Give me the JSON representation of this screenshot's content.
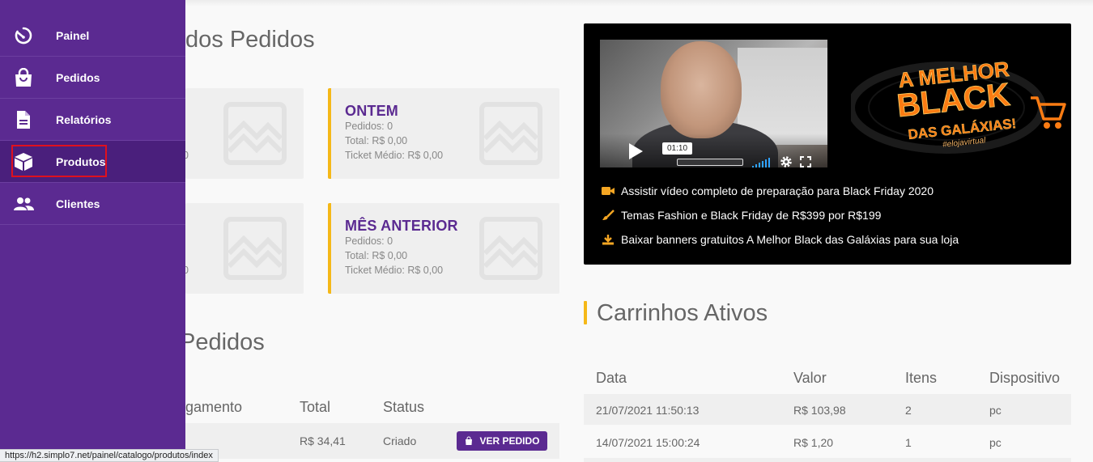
{
  "sidebar": {
    "items": [
      {
        "label": "Painel",
        "icon": "timer-icon"
      },
      {
        "label": "Pedidos",
        "icon": "shopping-bag-icon"
      },
      {
        "label": "Relatórios",
        "icon": "document-icon"
      },
      {
        "label": "Produtos",
        "icon": "box-icon"
      },
      {
        "label": "Clientes",
        "icon": "people-icon"
      }
    ],
    "active": "Produtos"
  },
  "summary": {
    "title": "dos Pedidos",
    "cards": [
      {
        "title": "",
        "edge_value": "0"
      },
      {
        "title": "ONTEM",
        "pedidos": "Pedidos: 0",
        "total": "Total: R$ 0,00",
        "ticket": "Ticket Médio: R$ 0,00"
      },
      {
        "title": "",
        "edge_value": "0"
      },
      {
        "title": "MÊS ANTERIOR",
        "pedidos": "Pedidos: 0",
        "total": "Total: R$ 0,00",
        "ticket": "Ticket Médio: R$ 0,00"
      }
    ]
  },
  "orders": {
    "title": "Pedidos",
    "columns": [
      "gamento",
      "Total",
      "Status"
    ],
    "rows": [
      {
        "total": "R$ 34,41",
        "status": "Criado",
        "action": "VER PEDIDO"
      }
    ]
  },
  "promo": {
    "video": {
      "time": "01:10",
      "volume_level": 0.8
    },
    "logo": {
      "line1": "A MELHOR",
      "line2": "BLACK",
      "line3": "DAS GALÁXIAS!",
      "tag": "#elojavirtual"
    },
    "links": [
      {
        "text": "Assistir vídeo completo de preparação para Black Friday 2020",
        "icon": "video-camera-icon"
      },
      {
        "text": "Temas Fashion e Black Friday de R$399 por R$199",
        "icon": "brush-icon"
      },
      {
        "text": "Baixar banners gratuitos A Melhor Black das Galáxias para sua loja",
        "icon": "download-icon"
      }
    ]
  },
  "carts": {
    "title": "Carrinhos Ativos",
    "columns": [
      "Data",
      "Valor",
      "Itens",
      "Dispositivo"
    ],
    "rows": [
      {
        "data": "21/07/2021 11:50:13",
        "valor": "R$ 103,98",
        "itens": "2",
        "dispositivo": "pc"
      },
      {
        "data": "14/07/2021 15:00:24",
        "valor": "R$ 1,20",
        "itens": "1",
        "dispositivo": "pc"
      }
    ]
  },
  "colors": {
    "primary": "#5b2a91",
    "accent": "#f5b818",
    "highlight": "#e0101e"
  },
  "status_url": "https://h2.simplo7.net/painel/catalogo/produtos/index"
}
